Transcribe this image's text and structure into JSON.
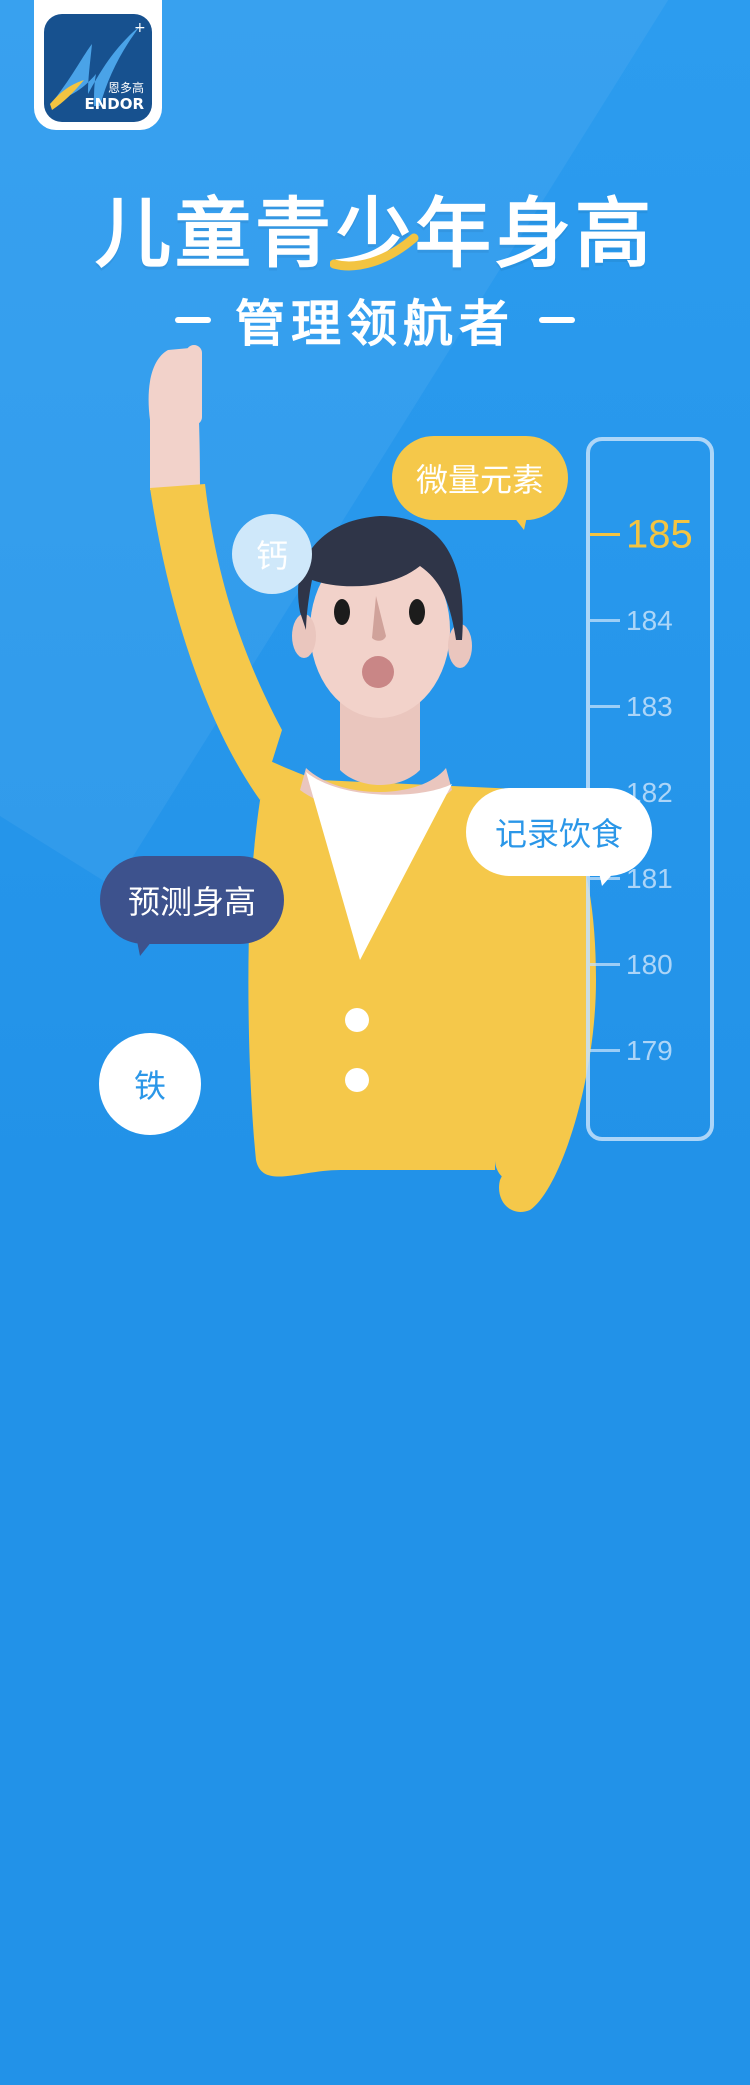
{
  "brand": {
    "name": "ENDOR",
    "cn_name": "恩多高"
  },
  "title": {
    "main": "儿童青少年身高",
    "sub": "管理领航者"
  },
  "ruler": {
    "ticks": [
      {
        "label": "185",
        "active": true
      },
      {
        "label": "184",
        "active": false
      },
      {
        "label": "183",
        "active": false
      },
      {
        "label": "182",
        "active": false
      },
      {
        "label": "181",
        "active": false
      },
      {
        "label": "180",
        "active": false
      },
      {
        "label": "179",
        "active": false
      }
    ]
  },
  "bubbles": {
    "trace_elements": "微量元素",
    "calcium": "钙",
    "record_diet": "记录饮食",
    "predict_height": "预测身高",
    "iron": "铁"
  },
  "colors": {
    "background": "#2292e8",
    "accent_yellow": "#f5c84a",
    "navy": "#3d528d",
    "ruler_line": "#c4e0fa"
  }
}
